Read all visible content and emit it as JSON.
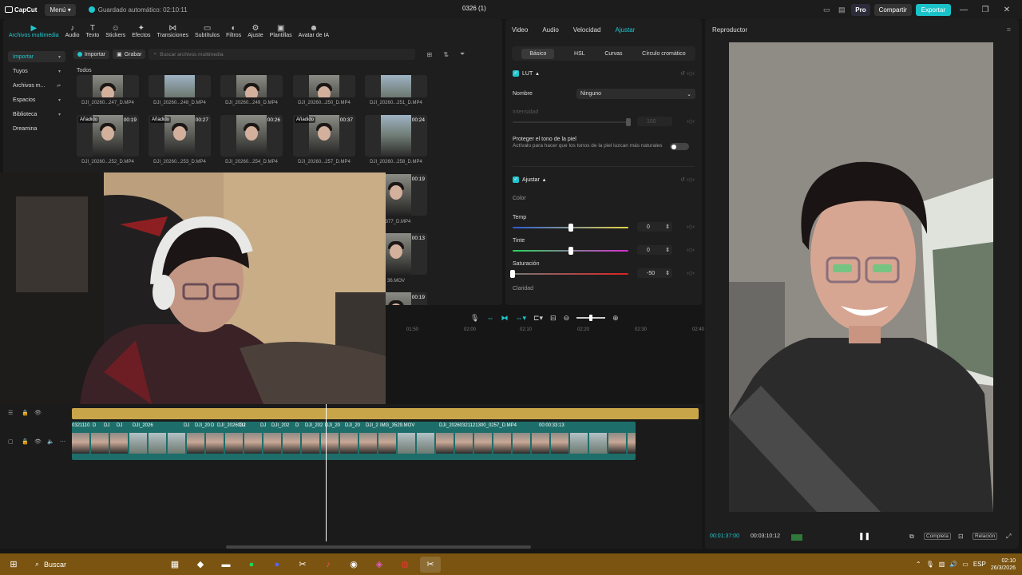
{
  "titlebar": {
    "app_name": "CapCut",
    "menu": "Menú",
    "autosave": "Guardado automático: 02:10:11",
    "project": "0326 (1)",
    "pro": "Pro",
    "share": "Compartir",
    "export": "Exportar"
  },
  "media_tabs": [
    {
      "label": "Archivos multimedia",
      "icon": "media-icon"
    },
    {
      "label": "Audio",
      "icon": "audio-icon"
    },
    {
      "label": "Texto",
      "icon": "text-icon"
    },
    {
      "label": "Stickers",
      "icon": "sticker-icon"
    },
    {
      "label": "Efectos",
      "icon": "effects-icon"
    },
    {
      "label": "Transiciones",
      "icon": "transitions-icon"
    },
    {
      "label": "Subtítulos",
      "icon": "subtitles-icon"
    },
    {
      "label": "Filtros",
      "icon": "filters-icon"
    },
    {
      "label": "Ajuste",
      "icon": "adjust-icon"
    },
    {
      "label": "Plantillas",
      "icon": "templates-icon"
    },
    {
      "label": "Avatar de IA",
      "icon": "avatar-icon"
    }
  ],
  "media_side": [
    "Importar",
    "Tuyos",
    "Archivos m...",
    "Espacios",
    "Biblioteca",
    "Dreamina"
  ],
  "media_toolbar": {
    "import": "Importar",
    "record": "Grabar",
    "search_placeholder": "Buscar archivos multimedia",
    "all": "Todos"
  },
  "thumbs_row1": [
    "DJI_20260...247_D.MP4",
    "DJI_20260...248_D.MP4",
    "DJI_20260...249_D.MP4",
    "DJI_20260...250_D.MP4",
    "DJI_20260...251_D.MP4"
  ],
  "thumbs_row2": [
    {
      "name": "DJI_20260...252_D.MP4",
      "tag": "Añadido",
      "dur": "00:19"
    },
    {
      "name": "DJI_20260...253_D.MP4",
      "tag": "Añadido",
      "dur": "00:27"
    },
    {
      "name": "DJI_20260...254_D.MP4",
      "tag": "",
      "dur": "00:26"
    },
    {
      "name": "DJI_20260...257_D.MP4",
      "tag": "Añadido",
      "dur": "00:37"
    },
    {
      "name": "DJI_20260...258_D.MP4",
      "tag": "",
      "dur": "00:24"
    }
  ],
  "thumbs_side": [
    {
      "name": "...377_D.MP4",
      "dur": "00:19"
    },
    {
      "name": "36.MOV",
      "dur": "00:13"
    },
    {
      "name": "",
      "dur": "00:19"
    }
  ],
  "props": {
    "tabs": [
      "Video",
      "Audio",
      "Velocidad",
      "Ajustar"
    ],
    "subtabs": [
      "Básico",
      "HSL",
      "Curvas",
      "Círculo cromático"
    ],
    "lut": "LUT",
    "name_label": "Nombre",
    "name_value": "Ninguno",
    "intensity": "Intensidad",
    "intensity_value": "100",
    "skin_title": "Proteger el tono de la piel",
    "skin_desc": "Actívalo para hacer que los tonos de la piel luzcan más naturales",
    "adjust": "Ajustar",
    "color": "Color",
    "sliders": [
      {
        "label": "Temp",
        "value": "0",
        "pos": 0.5
      },
      {
        "label": "Tinte",
        "value": "0",
        "pos": 0.5
      },
      {
        "label": "Saturación",
        "value": "-50",
        "pos": 0.0
      }
    ],
    "clarity": "Claridad"
  },
  "player": {
    "title": "Reproductor",
    "current": "00:01:37:00",
    "total": "00:03:10:12",
    "full": "Completa",
    "ratio": "Relación"
  },
  "ruler": [
    "01:50",
    "02:00",
    "02:10",
    "02:20",
    "02:30",
    "02:40"
  ],
  "timeline_labels": [
    "0321110",
    "D",
    "DJ",
    "DJ",
    "DJI_2026",
    "DJ",
    "DJI_20",
    "D",
    "DJI_2026032",
    "DJ",
    "DJ",
    "DJI_202",
    "D",
    "DJI_202",
    "DJI_20",
    "DJI_20",
    "DJI_2",
    "IMG_3529.MOV",
    "DJI_20260321121300_0257_D.MP4",
    "00:00:33:13"
  ],
  "taskbar": {
    "search": "Buscar",
    "lang": "ESP",
    "time": "02:10",
    "date": "26/3/2026"
  }
}
